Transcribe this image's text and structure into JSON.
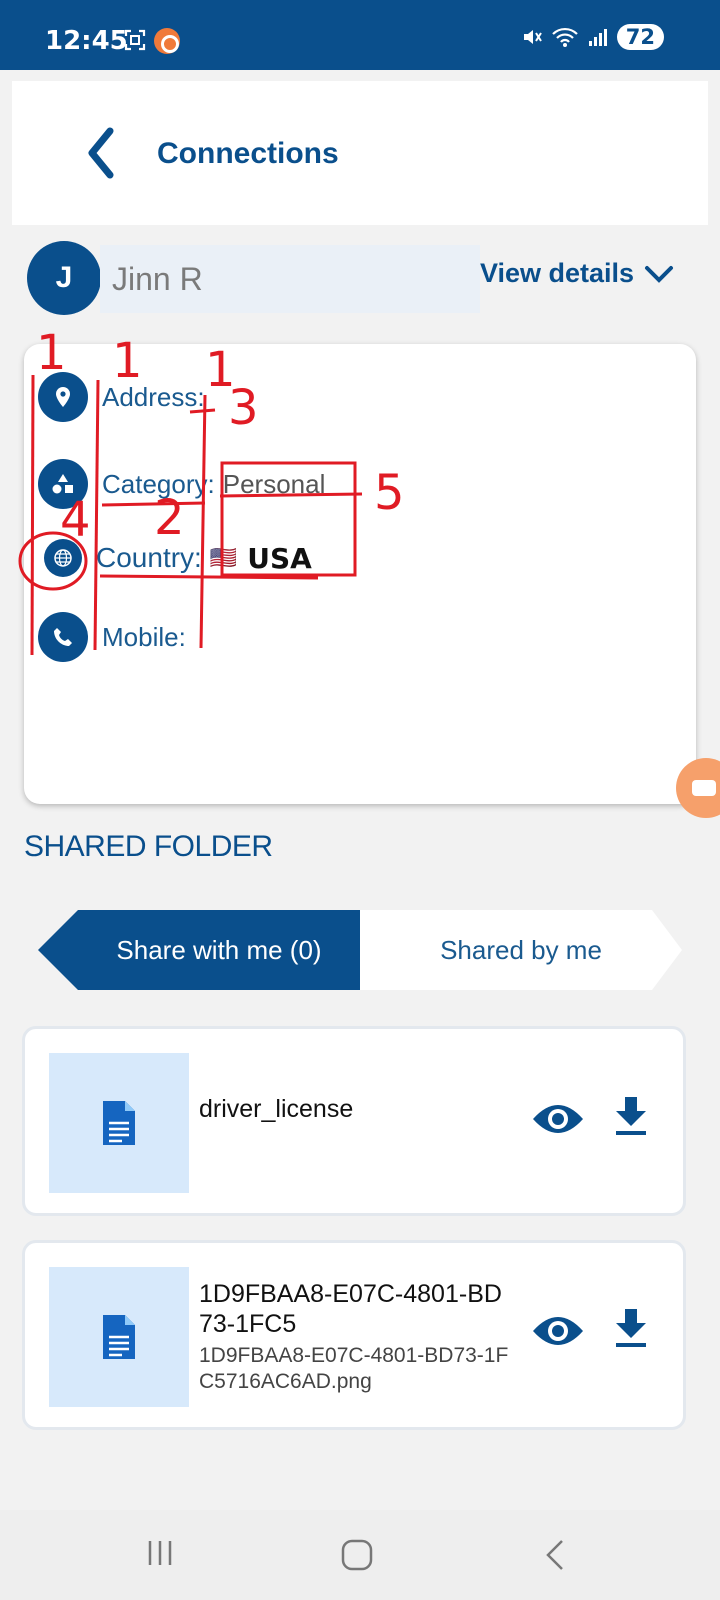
{
  "status_bar": {
    "time": "12:45",
    "battery": "72",
    "icons": [
      "screenshot-icon",
      "screen-record-icon",
      "mute-icon",
      "wifi-icon",
      "signal-icon"
    ]
  },
  "header": {
    "title": "Connections",
    "back_icon": "back-chevron-icon"
  },
  "contact": {
    "initial": "J",
    "name": "Jinn R",
    "view_details_label": "View details"
  },
  "details": {
    "address": {
      "label": "Address:",
      "value": ""
    },
    "category": {
      "label": "Category:",
      "value": "Personal"
    },
    "country": {
      "label": "Country:",
      "flag": "🇺🇸",
      "value": "USA"
    },
    "mobile": {
      "label": "Mobile:",
      "value": ""
    }
  },
  "annotations": {
    "numbers": [
      "1",
      "1",
      "1",
      "3",
      "5",
      "4",
      "2"
    ],
    "color": "#e01b24"
  },
  "shared_folder": {
    "title": "SHARED FOLDER",
    "tabs": [
      {
        "label": "Share with me (0)",
        "active": true
      },
      {
        "label": "Shared by me",
        "active": false
      }
    ],
    "files": [
      {
        "name": "driver_license",
        "filename": ""
      },
      {
        "name": "1D9FBAA8-E07C-4801-BD73-1FC5",
        "filename": "1D9FBAA8-E07C-4801-BD73-1FC5716AC6AD.png"
      }
    ]
  },
  "colors": {
    "primary": "#0a4f8c",
    "background": "#f2f2f2",
    "thumb_bg": "#d7e9fb",
    "annotation": "#e01b24"
  }
}
